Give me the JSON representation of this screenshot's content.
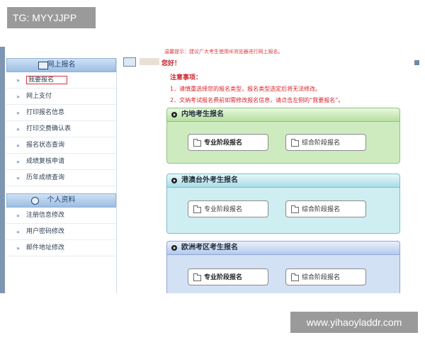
{
  "watermarks": {
    "top": "TG: MYYJJPP",
    "bottom": "www.yihaoyladdr.com"
  },
  "header": {
    "top_notice": "温馨提示：建议广大考生使用IE浏览器进行网上报名。",
    "greeting": "您好！"
  },
  "sidebar": {
    "section1_title": "网上报名",
    "section1_items": [
      "我要报名",
      "网上支付",
      "打印报名信息",
      "打印交费确认表",
      "报名状态查询",
      "成绩复核申请",
      "历年成绩查询"
    ],
    "section2_title": "个人资料",
    "section2_items": [
      "注册信息修改",
      "用户密码修改",
      "邮件地址修改"
    ]
  },
  "notes": {
    "title": "注意事项：",
    "line1": "1．请慎重选择您的报名类型，报名类型选定后将无法修改。",
    "line2": "2．文纳考试报名费前如需修改报名信息，请点击左侧的“我要报名”。"
  },
  "panels": [
    {
      "title": "内地考生报名",
      "btn1": "专业阶段报名",
      "btn2": "综合阶段报名"
    },
    {
      "title": "港澳台外考生报名",
      "btn1": "专业阶段报名",
      "btn2": "综合阶段报名"
    },
    {
      "title": "欧洲考区考生报名",
      "btn1": "专业阶段报名",
      "btn2": "综合阶段报名"
    }
  ]
}
